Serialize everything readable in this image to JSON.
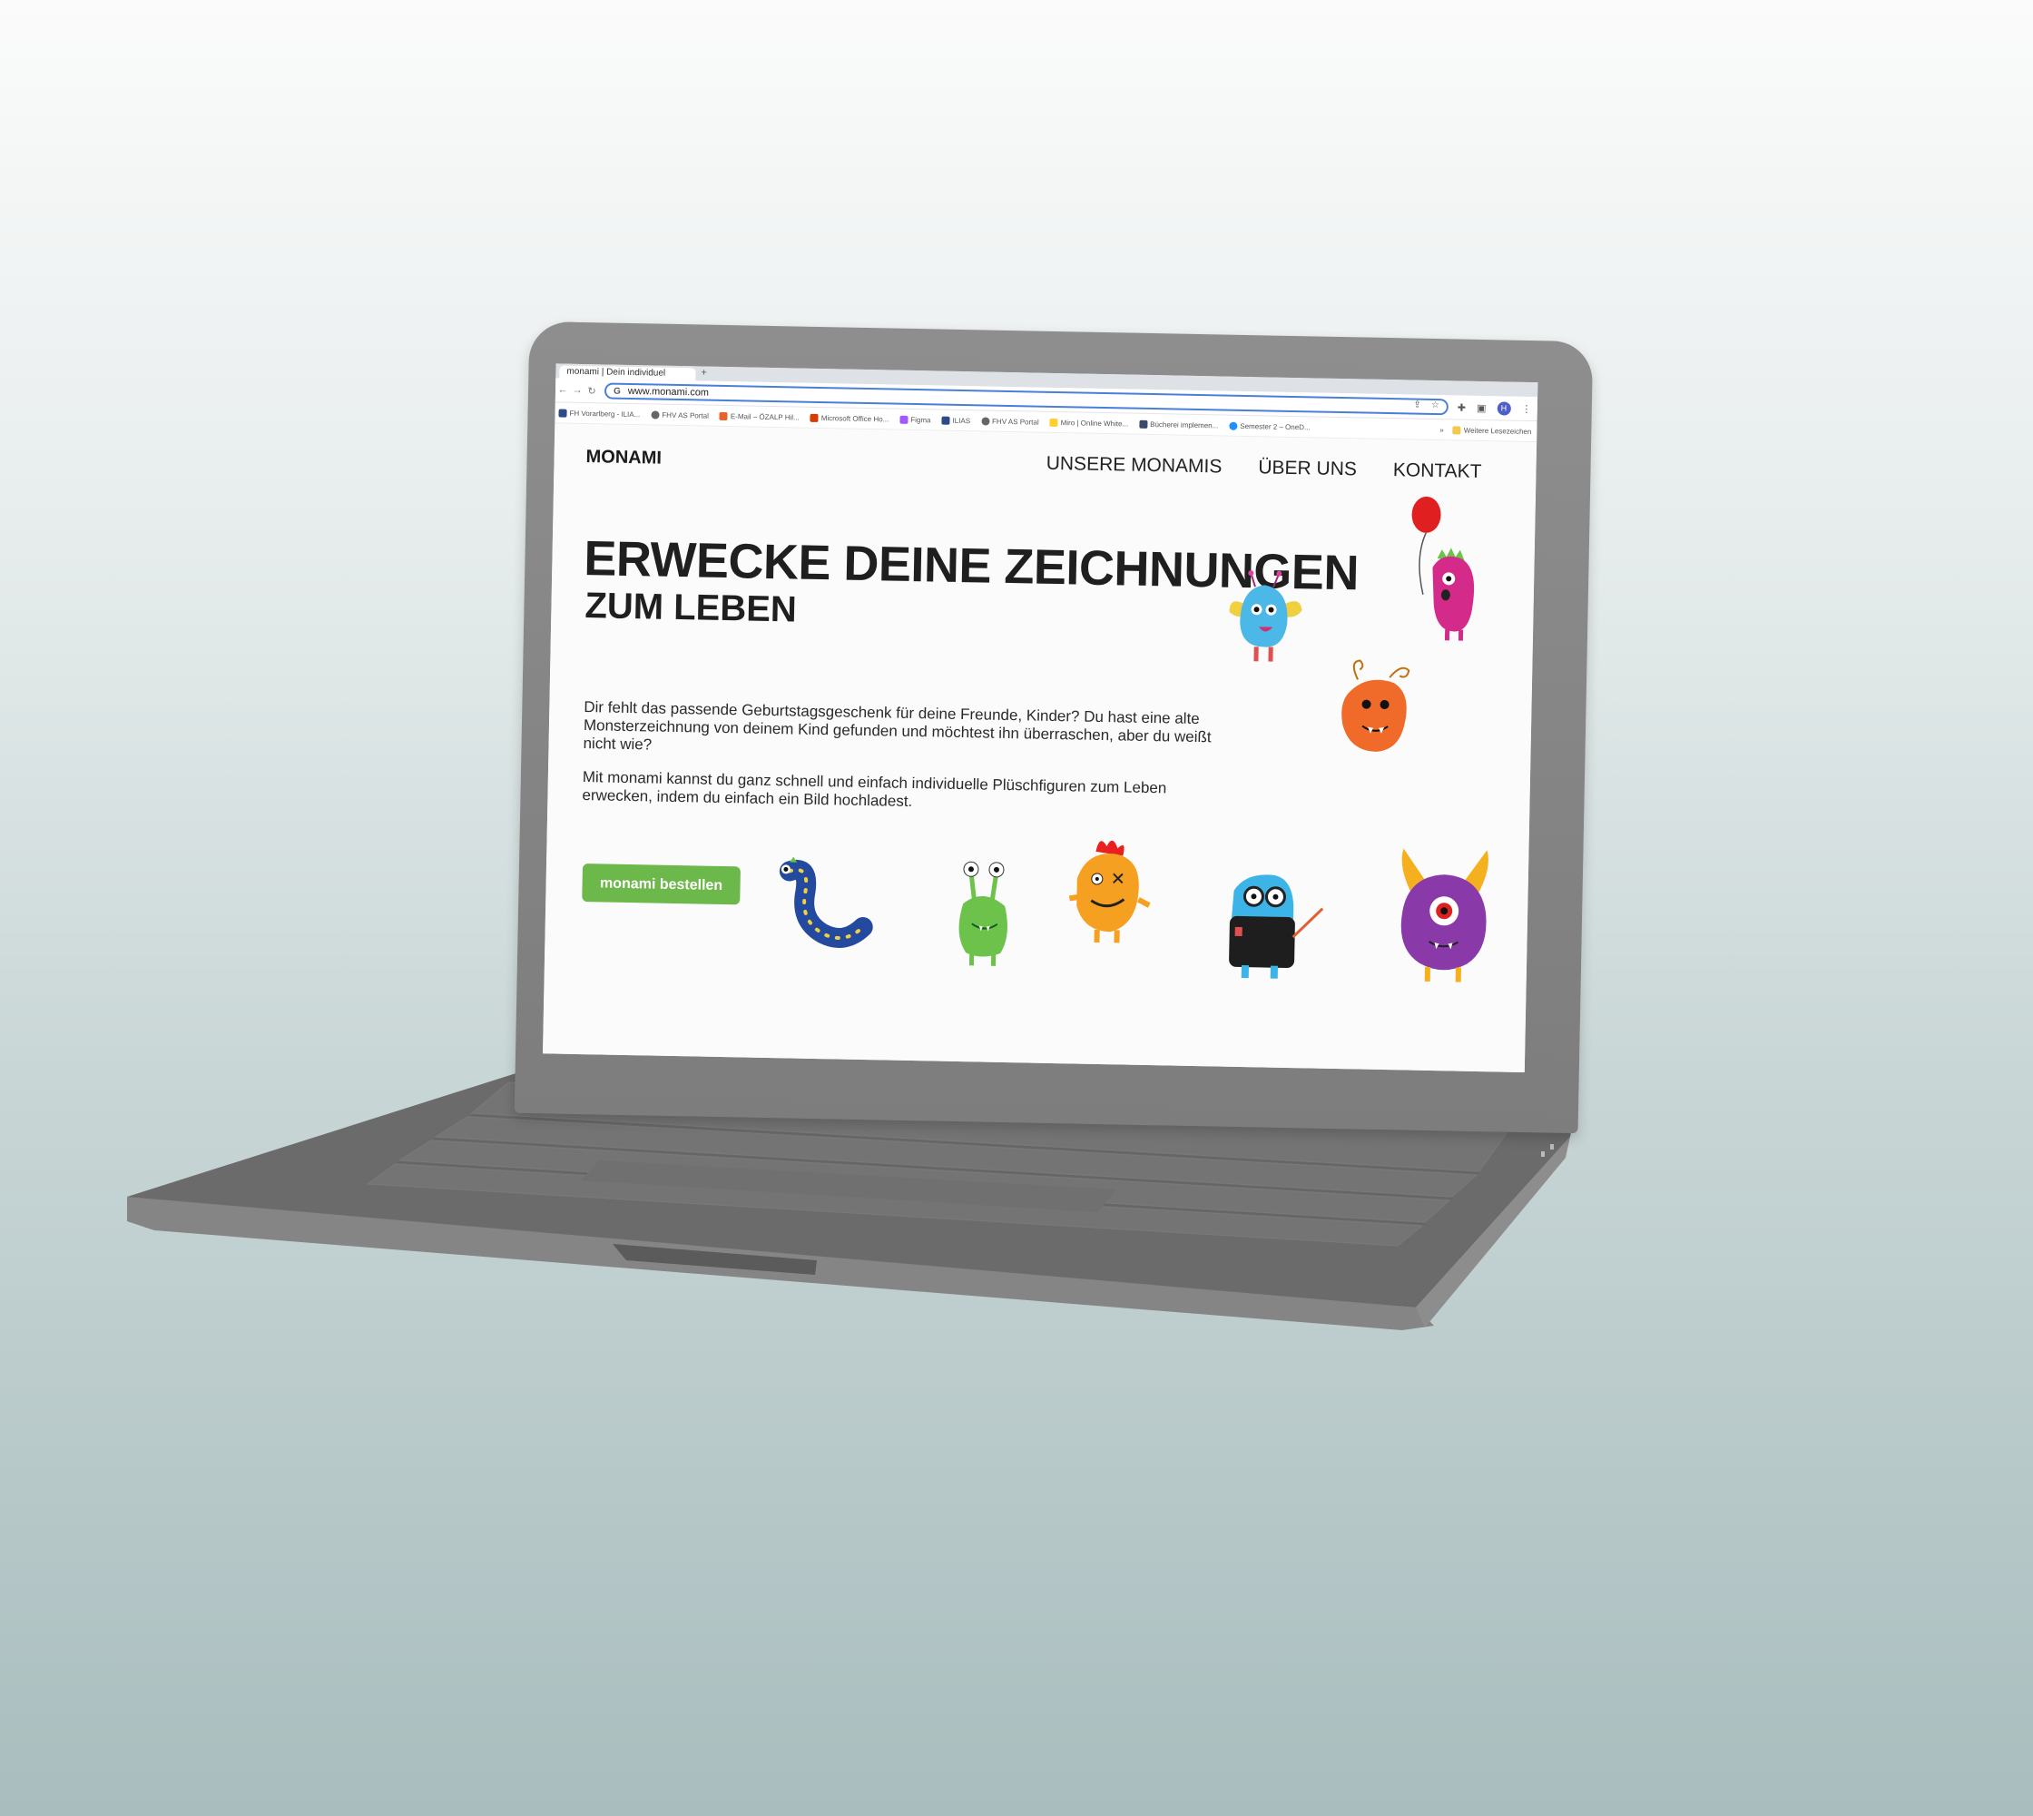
{
  "browser": {
    "tab_title": "monami | Dein individuel",
    "tab_add": "+",
    "url": "www.monami.com",
    "omnibox_icon": "G",
    "profile_initial": "H",
    "bookmarks": [
      "FH Vorarlberg - ILIA...",
      "FHV AS Portal",
      "E-Mail – ÖZALP Hil...",
      "Microsoft Office Ho...",
      "Figma",
      "ILIAS",
      "FHV AS Portal",
      "Miro | Online White...",
      "Bücherei implemen...",
      "Semester 2 – OneD..."
    ],
    "bookmarks_overflow": "»",
    "other_bookmarks": "Weitere Lesezeichen"
  },
  "site": {
    "logo": "MONAMI",
    "nav": [
      "UNSERE MONAMIS",
      "ÜBER UNS",
      "KONTAKT"
    ],
    "headline": "ERWECKE DEINE ZEICHNUNGEN",
    "subheadline": "ZUM LEBEN",
    "paragraph1": "Dir fehlt das passende Geburtstagsgeschenk für deine Freunde, Kinder? Du hast eine alte Monsterzeichnung von deinem Kind gefunden und möchtest ihn überraschen, aber du weißt nicht wie?",
    "paragraph2": "Mit monami kannst du ganz schnell und einfach individuelle Plüschfiguren zum Leben erwecken, indem du einfach ein Bild hochladest.",
    "cta_label": "monami bestellen"
  },
  "colors": {
    "cta": "#6cb84a",
    "accent_blue": "#4a7fd8",
    "laptop_body": "#808080"
  },
  "icons": [
    "back-arrow-icon",
    "forward-arrow-icon",
    "reload-icon",
    "share-icon",
    "star-icon",
    "extensions-icon",
    "sidepanel-icon",
    "menu-icon"
  ]
}
